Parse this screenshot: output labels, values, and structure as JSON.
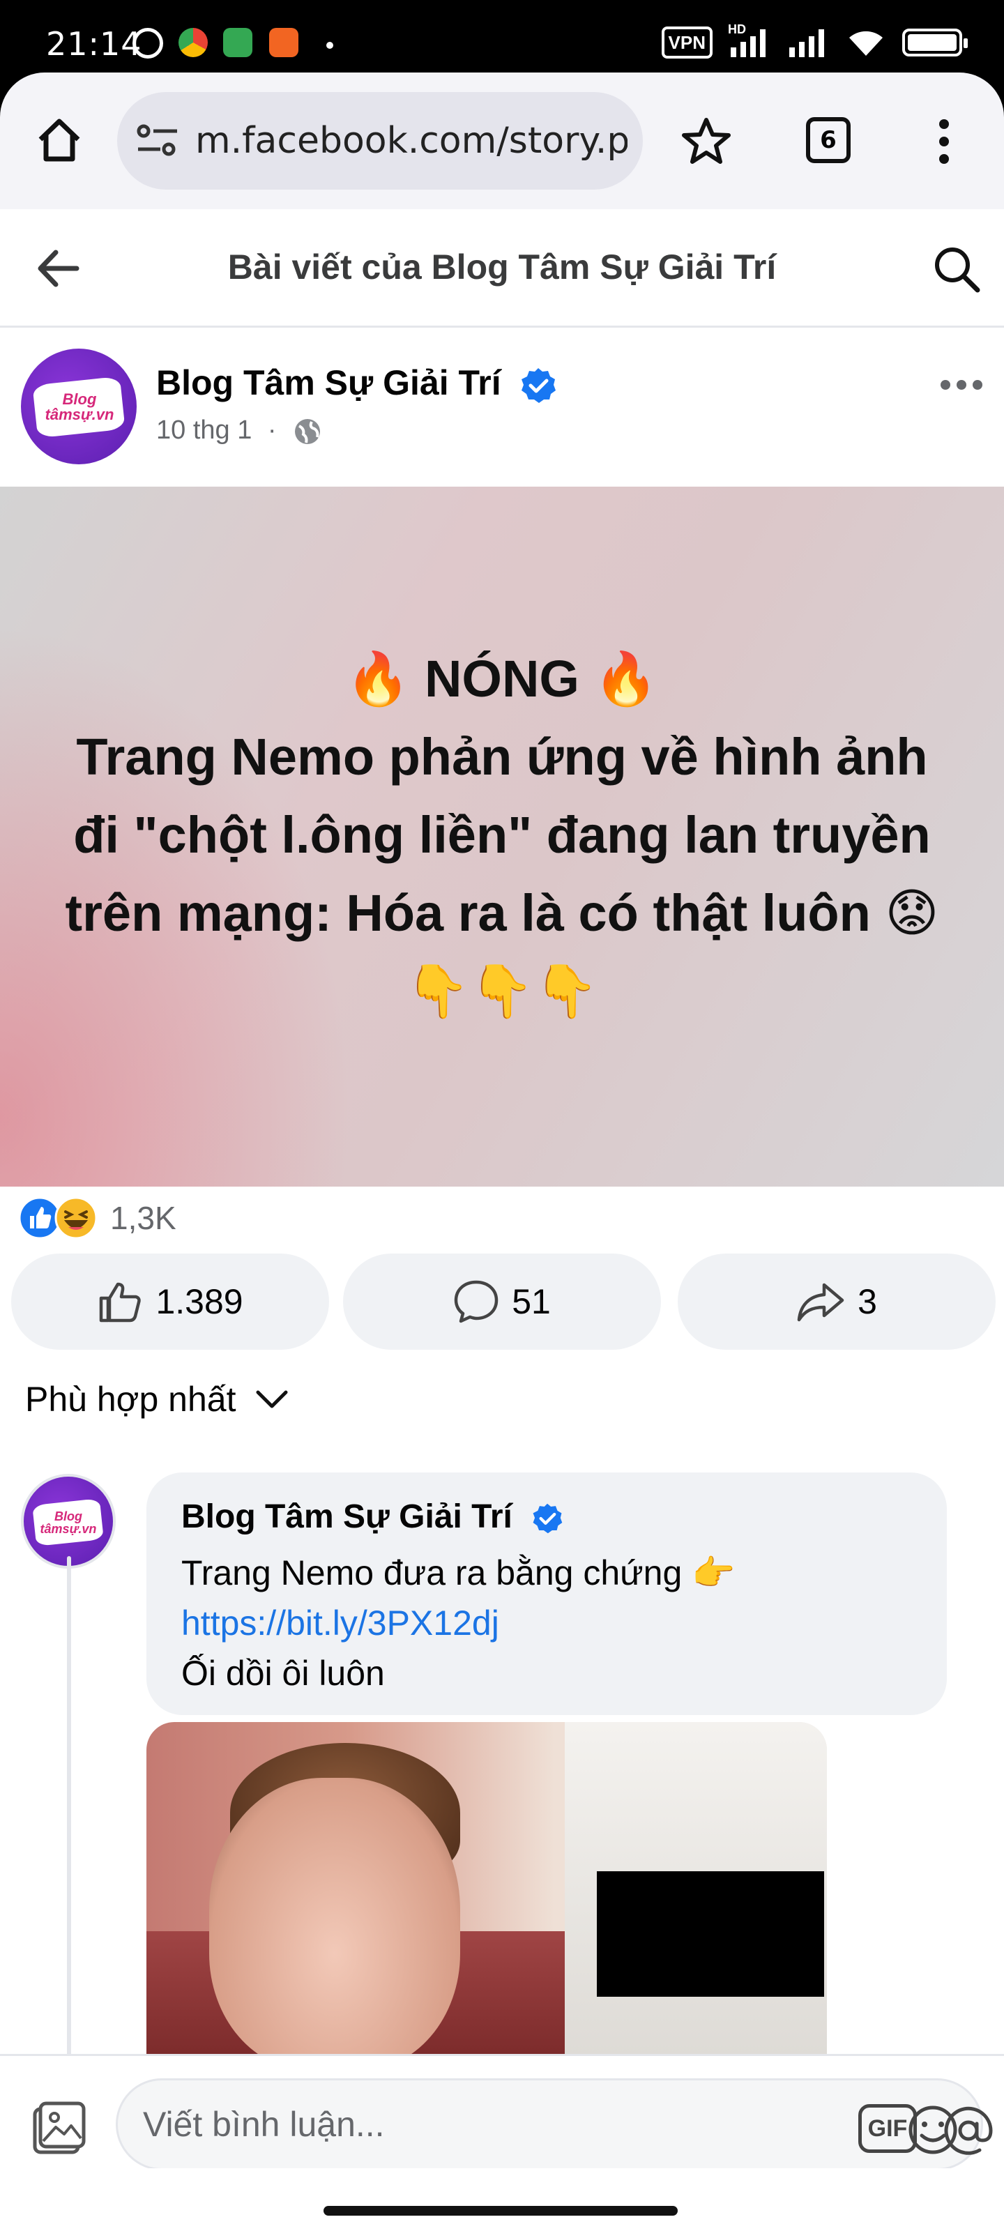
{
  "status_bar": {
    "time": "21:14",
    "vpn_label": "VPN",
    "network_label": "HD"
  },
  "browser": {
    "url": "m.facebook.com/story.p",
    "tab_count": "6"
  },
  "header": {
    "title": "Bài viết của Blog Tâm Sự Giải Trí"
  },
  "post": {
    "author": "Blog Tâm Sự Giải Trí",
    "date": "10 thg 1",
    "separator": "·",
    "avatar_logo_text": "Blog tâmsự.vn",
    "hero_lines": [
      "🔥 NÓNG 🔥",
      "Trang Nemo phản ứng về hình ảnh",
      "đi \"chột l.ông liền\" đang lan truyền",
      "trên mạng: Hóa ra là có thật luôn 😟",
      "👇👇👇"
    ],
    "reaction_count": "1,3K",
    "like_count": "1.389",
    "comment_count": "51",
    "share_count": "3"
  },
  "sort": {
    "label": "Phù hợp nhất"
  },
  "comment": {
    "author": "Blog Tâm Sự Giải Trí",
    "text_before_link": "Trang Nemo đưa ra bằng chứng 👉 ",
    "link": "https://bit.ly/3PX12dj",
    "text_line2": "Ối dồi ôi luôn"
  },
  "composer": {
    "placeholder": "Viết bình luận...",
    "gif_label": "GIF"
  },
  "colors": {
    "fb_blue": "#1877f2",
    "link_blue": "#1b74e4",
    "bg_gray": "#f0f2f5",
    "text_gray": "#65676b"
  }
}
